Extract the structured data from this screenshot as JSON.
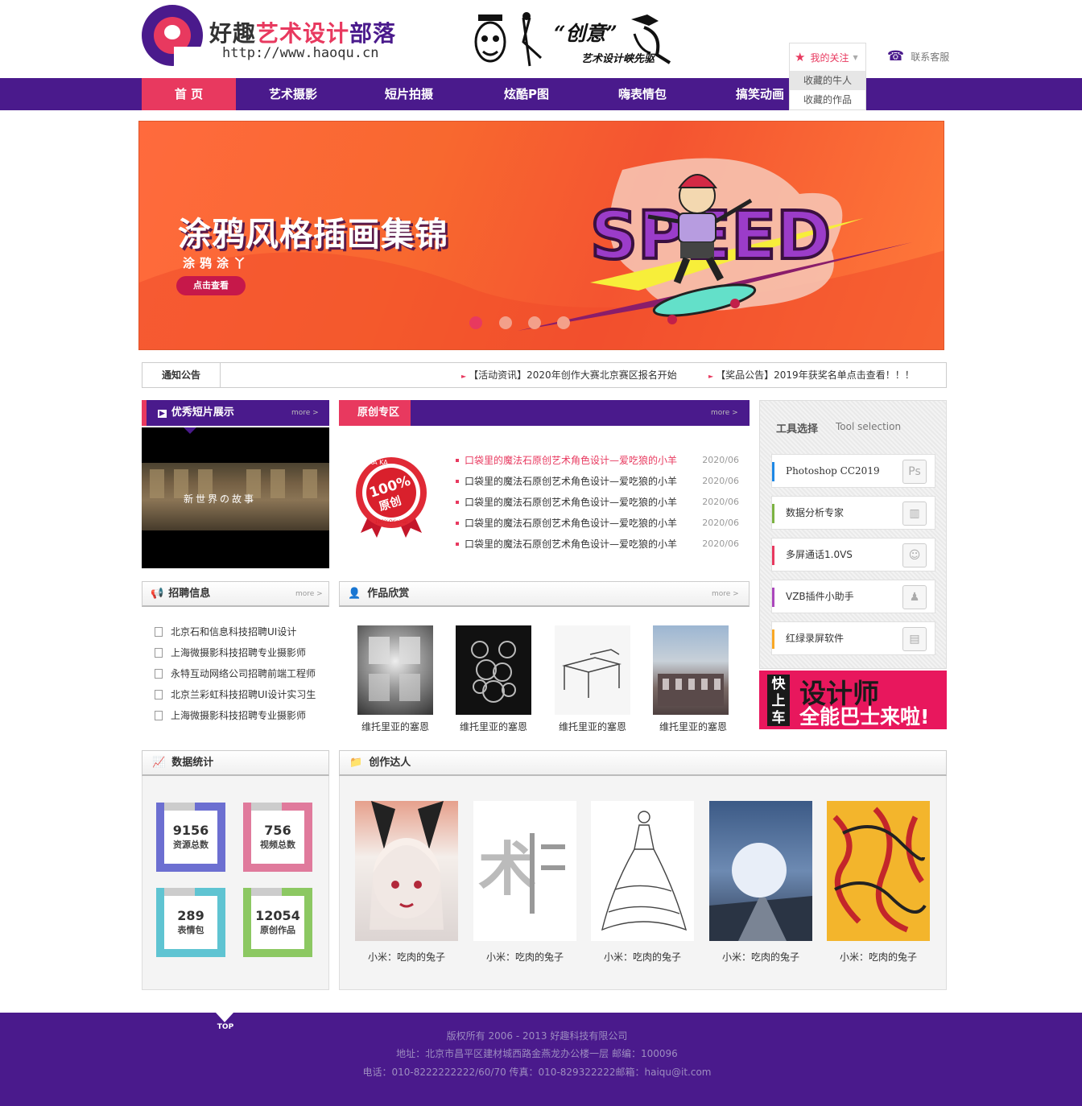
{
  "header": {
    "logo_prefix": "好趣",
    "logo_highlight": "艺术设计",
    "logo_suffix": "部落",
    "logo_url": "http://www.haoqu.cn",
    "slogan_main": "“创意”",
    "slogan_sub": "艺术设计峡先驱",
    "follow_label": "我的关注",
    "follow_items": [
      "收藏的牛人",
      "收藏的作品"
    ],
    "service_label": "联系客服"
  },
  "nav": [
    "首 页",
    "艺术摄影",
    "短片拍摄",
    "炫酷P图",
    "嗨表情包",
    "搞笑动画"
  ],
  "banner": {
    "title": "涂鸦风格插画集锦",
    "subtitle": "涂鸦涂丫",
    "button": "点击查看",
    "art_text": "SPEED",
    "slides": 4,
    "active_slide": 1
  },
  "notice": {
    "label": "通知公告",
    "items": [
      "【活动资讯】2020年创作大赛北京赛区报名开始",
      "【奖品公告】2019年获奖名单点击查看！！！"
    ]
  },
  "video_section": {
    "title": "优秀短片展示",
    "more": "more >",
    "caption": "新世界の故事"
  },
  "original": {
    "title": "原创专区",
    "more": "more >",
    "badge_top": "KA  KA",
    "badge_main": "100%",
    "badge_sub": "原创",
    "badge_en": "100%Original",
    "items": [
      {
        "title": "口袋里的魔法石原创艺术角色设计—爱吃狼的小羊",
        "date": "2020/06"
      },
      {
        "title": "口袋里的魔法石原创艺术角色设计—爱吃狼的小羊",
        "date": "2020/06"
      },
      {
        "title": "口袋里的魔法石原创艺术角色设计—爱吃狼的小羊",
        "date": "2020/06"
      },
      {
        "title": "口袋里的魔法石原创艺术角色设计—爱吃狼的小羊",
        "date": "2020/06"
      },
      {
        "title": "口袋里的魔法石原创艺术角色设计—爱吃狼的小羊",
        "date": "2020/06"
      }
    ]
  },
  "tools": {
    "title": "工具选择",
    "subtitle": "Tool selection",
    "items": [
      {
        "name": "Photoshop CC2019",
        "color": "#1e88e5",
        "icon": "Ps"
      },
      {
        "name": "数据分析专家",
        "color": "#7cb342",
        "icon": "chart-icon"
      },
      {
        "name": "多屏通话1.0VS",
        "color": "#e8395f",
        "icon": "people-icon"
      },
      {
        "name": "VZB插件小助手",
        "color": "#ab47bc",
        "icon": "team-icon"
      },
      {
        "name": "红绿录屏软件",
        "color": "#f9a825",
        "icon": "presentation-icon"
      }
    ]
  },
  "promo": {
    "tag": "快上车",
    "line1": "设计师",
    "line2": "全能巴士来啦!"
  },
  "recruit": {
    "title": "招聘信息",
    "more": "more >",
    "items": [
      "北京石和信息科技招聘UI设计",
      "上海微摄影科技招聘专业摄影师",
      "永特互动网络公司招聘前端工程师",
      "北京兰彩虹科技招聘UI设计实习生",
      "上海微摄影科技招聘专业摄影师"
    ]
  },
  "works": {
    "title": "作品欣赏",
    "more": "more >",
    "items": [
      "维托里亚的塞恩",
      "维托里亚的塞恩",
      "维托里亚的塞恩",
      "维托里亚的塞恩"
    ]
  },
  "stats": {
    "title": "数据统计",
    "items": [
      {
        "value": "9156",
        "label": "资源总数",
        "color": "#6c6fd1"
      },
      {
        "value": "756",
        "label": "视频总数",
        "color": "#e07a9c"
      },
      {
        "value": "289",
        "label": "表情包",
        "color": "#5fc4d2"
      },
      {
        "value": "12054",
        "label": "原创作品",
        "color": "#8cc862"
      }
    ]
  },
  "experts": {
    "title": "创作达人",
    "items": [
      "小米：吃肉的兔子",
      "小米：吃肉的兔子",
      "小米：吃肉的兔子",
      "小米：吃肉的兔子",
      "小米：吃肉的兔子"
    ]
  },
  "footer": {
    "top_label": "TOP",
    "copyright": "版权所有 2006 - 2013 好趣科技有限公司",
    "address": "地址：北京市昌平区建材城西路金燕龙办公楼一层 邮编：100096",
    "contact": "电话：010-8222222222/60/70 传真：010-829322222邮箱：haiqu@it.com"
  },
  "colors": {
    "brand_purple": "#4a1a8c",
    "brand_pink": "#e8395f"
  }
}
